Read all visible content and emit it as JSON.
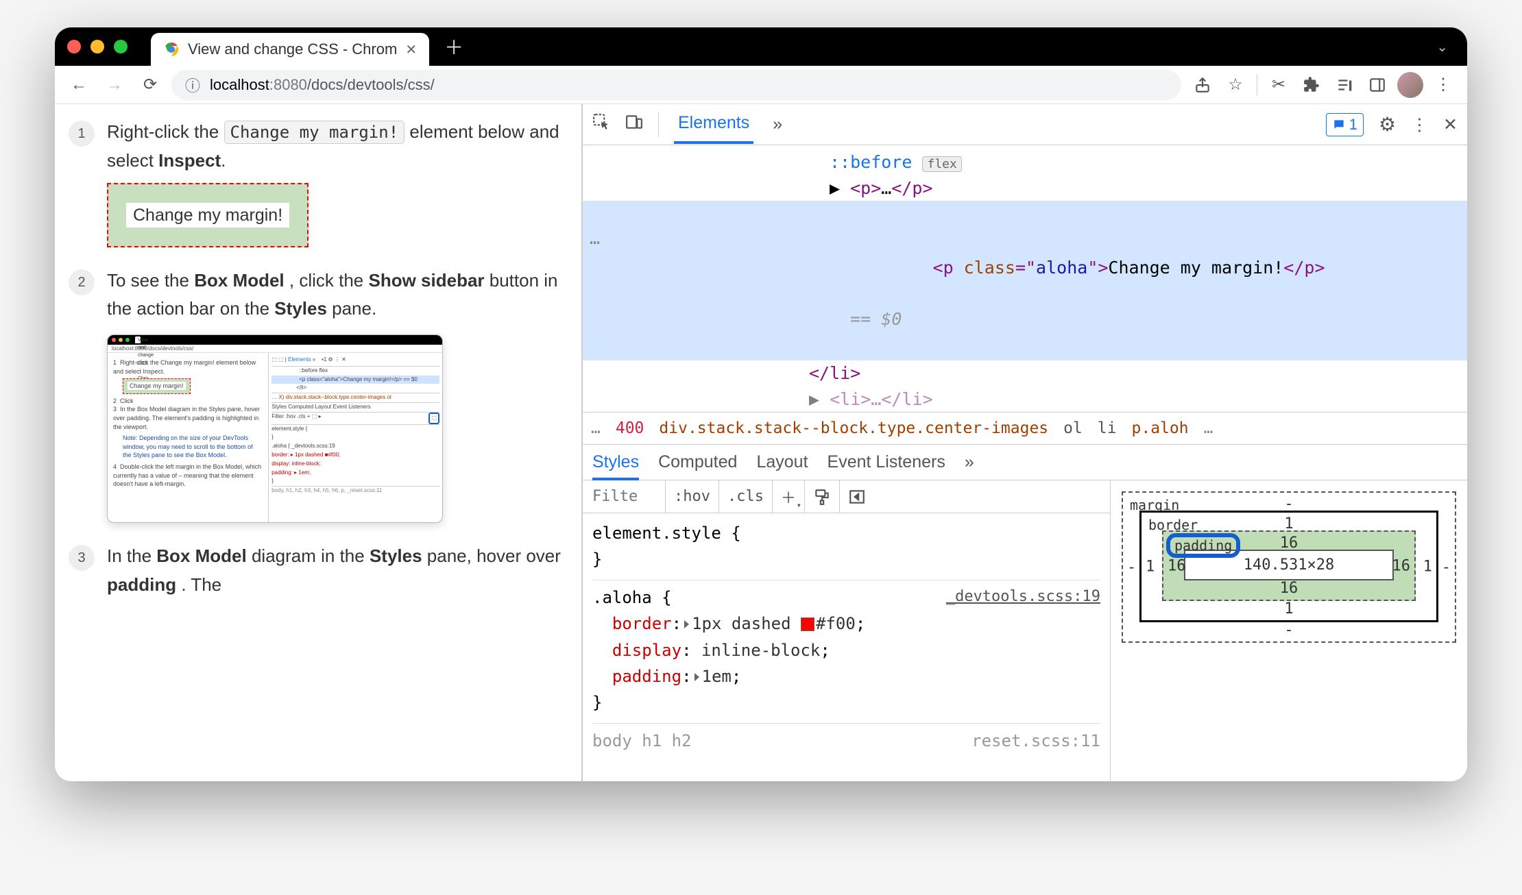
{
  "tab": {
    "title": "View and change CSS - Chrom"
  },
  "url": {
    "host": "localhost",
    "port": ":8080",
    "path": "/docs/devtools/css/"
  },
  "steps": {
    "s1a": "Right-click the ",
    "s1code": "Change my margin!",
    "s1b": " element below and select ",
    "s1bold": "Inspect",
    "demo": "Change my margin!",
    "s2a": "To see the ",
    "s2b": ", click the ",
    "s2c": " button in the action bar on the ",
    "s2d": " pane.",
    "s2_boxmodel": "Box Model",
    "s2_show": "Show sidebar",
    "s2_styles": "Styles",
    "s3a": "In the ",
    "s3b": " diagram in the ",
    "s3c": " pane, hover over ",
    "s3d": ". The",
    "s3_boxmodel": "Box Model",
    "s3_styles": "Styles",
    "s3_padding": "padding"
  },
  "dt_tabs": {
    "elements": "Elements",
    "issues_count": "1"
  },
  "dom": {
    "before": "::before",
    "flex": "flex",
    "p_open": "<p>",
    "ellipsis": "…",
    "p_close": "</p>",
    "sel_open": "<p ",
    "sel_class": "class",
    "sel_eq": "=\"",
    "sel_val": "aloha",
    "sel_close": "\">",
    "sel_text": "Change my margin!",
    "sel_end": "</p>",
    "dollar": " == $0",
    "li_close": "</li>",
    "li2": "<li>…</li>"
  },
  "crumbs": {
    "num": "400",
    "main": "div.stack.stack--block.type.center-images",
    "ol": "ol",
    "li": "li",
    "paloh": "p.aloh"
  },
  "styles_tabs": {
    "styles": "Styles",
    "computed": "Computed",
    "layout": "Layout",
    "listeners": "Event Listeners"
  },
  "filter": {
    "placeholder": "Filte",
    "hov": ":hov",
    "cls": ".cls"
  },
  "rules": {
    "element": "element.style {",
    "aloha_sel": ".aloha {",
    "aloha_src": "_devtools.scss:19",
    "border_n": "border",
    "border_v": "1px dashed ",
    "border_hex": "#f00",
    "display_n": "display",
    "display_v": "inline-block",
    "padding_n": "padding",
    "padding_v": "1em",
    "body_sel": "body h1 h2",
    "reset_src": "reset.scss:11"
  },
  "box_model": {
    "margin": "margin",
    "border": "border",
    "padding": "padding",
    "m_t": "-",
    "m_b": "-",
    "m_l": "-",
    "m_r": "-",
    "b_t": "1",
    "b_b": "1",
    "b_l": "1",
    "b_r": "1",
    "p_t": "16",
    "p_b": "16",
    "p_l": "16",
    "p_r": "16",
    "content": "140.531×28"
  },
  "thumb": {
    "url": "localhost:8080/docs/devtools/css/",
    "tab_title": "View and change CSS - Chro…",
    "l1": "Right-click the Change my margin! element below and select Inspect.",
    "demo": "Change my margin!",
    "l3": "Click",
    "l4": "In the Box Model diagram in the Styles pane, hover over padding. The element's padding is highlighted in the viewport.",
    "note": "Note: Depending on the size of your DevTools window, you may need to scroll to the bottom of the Styles pane to see the Box Model.",
    "l5": "Double-click the left margin in the Box Model, which currently has a value of – meaning that the element doesn't have a left-margin.",
    "r_before": "::before  flex",
    "r_sel": "<p class=\"aloha\">Change my margin!</p> == $0",
    "r_li": "</li>",
    "r_crumb": "… X) div.stack.stack--block.type.center-images  ol",
    "r_tabs": "Styles  Computed  Layout  Event Listeners",
    "r_filter": "Filter          :hov .cls + ⬚ ▸",
    "r_es": "element.style {",
    "r_aloha": ".aloha {                _devtools.scss:19",
    "r_b": "  border: ▸ 1px dashed ■#f00;",
    "r_d": "  display: inline-block;",
    "r_p": "  padding: ▸ 1em;",
    "r_body": "body, h1, h2, h3, h4, h5, h6, p, _reset.scss:11"
  }
}
